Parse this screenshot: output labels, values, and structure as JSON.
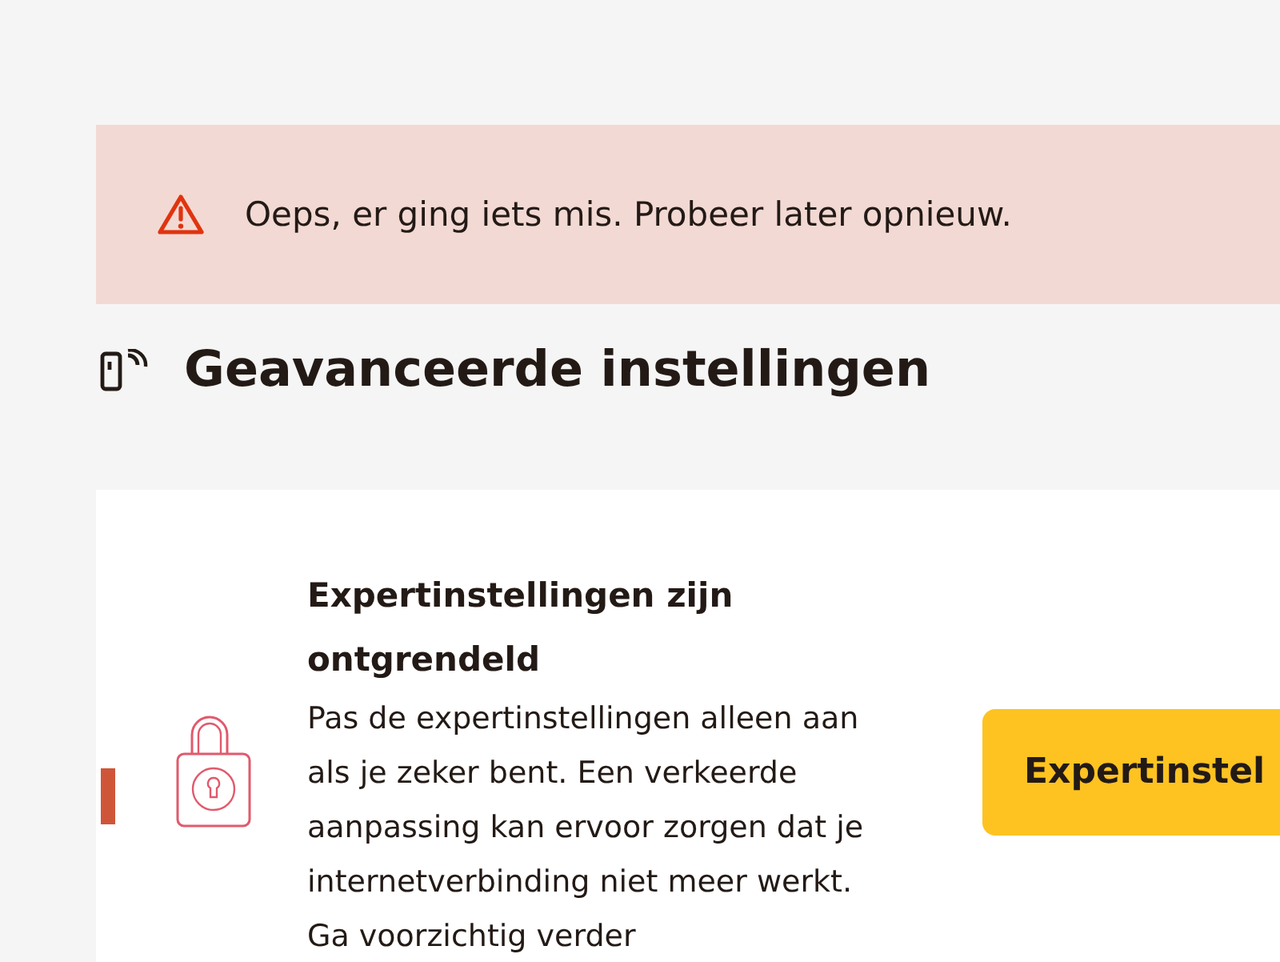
{
  "alert": {
    "message": "Oeps, er ging iets mis. Probeer later opnieuw."
  },
  "section": {
    "title": "Geavanceerde instellingen"
  },
  "card": {
    "title": "Expertinstellingen zijn ontgrendeld",
    "body": "Pas de expertinstellingen alleen aan als je zeker bent. Een verkeerde aanpassing kan ervoor zorgen dat je internetverbinding niet meer werkt. Ga voorzichtig verder",
    "button": "Expertinstel"
  }
}
